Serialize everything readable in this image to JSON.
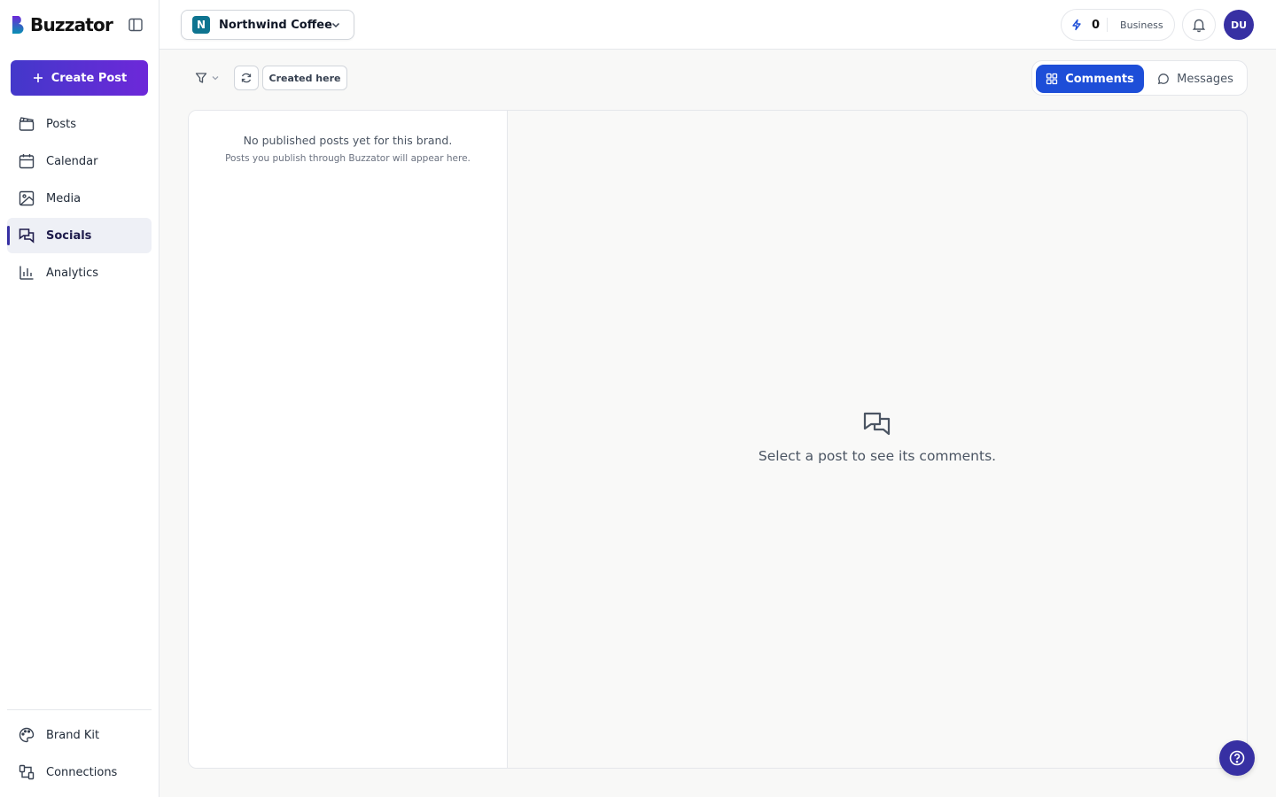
{
  "app": {
    "logo_text": "Buzzator"
  },
  "sidebar": {
    "create_label": "Create Post",
    "items": [
      {
        "label": "Posts",
        "icon": "clapperboard-icon"
      },
      {
        "label": "Calendar",
        "icon": "calendar-icon"
      },
      {
        "label": "Media",
        "icon": "image-icon"
      },
      {
        "label": "Socials",
        "icon": "chat-bubbles-icon",
        "active": true
      },
      {
        "label": "Analytics",
        "icon": "bar-chart-icon"
      }
    ],
    "bottom_items": [
      {
        "label": "Brand Kit",
        "icon": "palette-icon"
      },
      {
        "label": "Connections",
        "icon": "connections-icon"
      }
    ]
  },
  "topbar": {
    "brand_initial": "N",
    "brand_name": "Northwind Coffee",
    "credits_count": "0",
    "plan": "Business",
    "avatar_initials": "DU"
  },
  "toolbar": {
    "created_here_label": "Created here",
    "tabs": {
      "comments": "Comments",
      "messages": "Messages",
      "active": "comments"
    }
  },
  "posts_list": {
    "empty_title": "No published posts yet for this brand.",
    "empty_subtitle": "Posts you publish through Buzzator will appear here."
  },
  "detail": {
    "empty_text": "Select a post to see its comments."
  },
  "colors": {
    "accent": "#3730a3",
    "tab_active": "#1d4ed8",
    "brand_badge": "#0e7490"
  }
}
